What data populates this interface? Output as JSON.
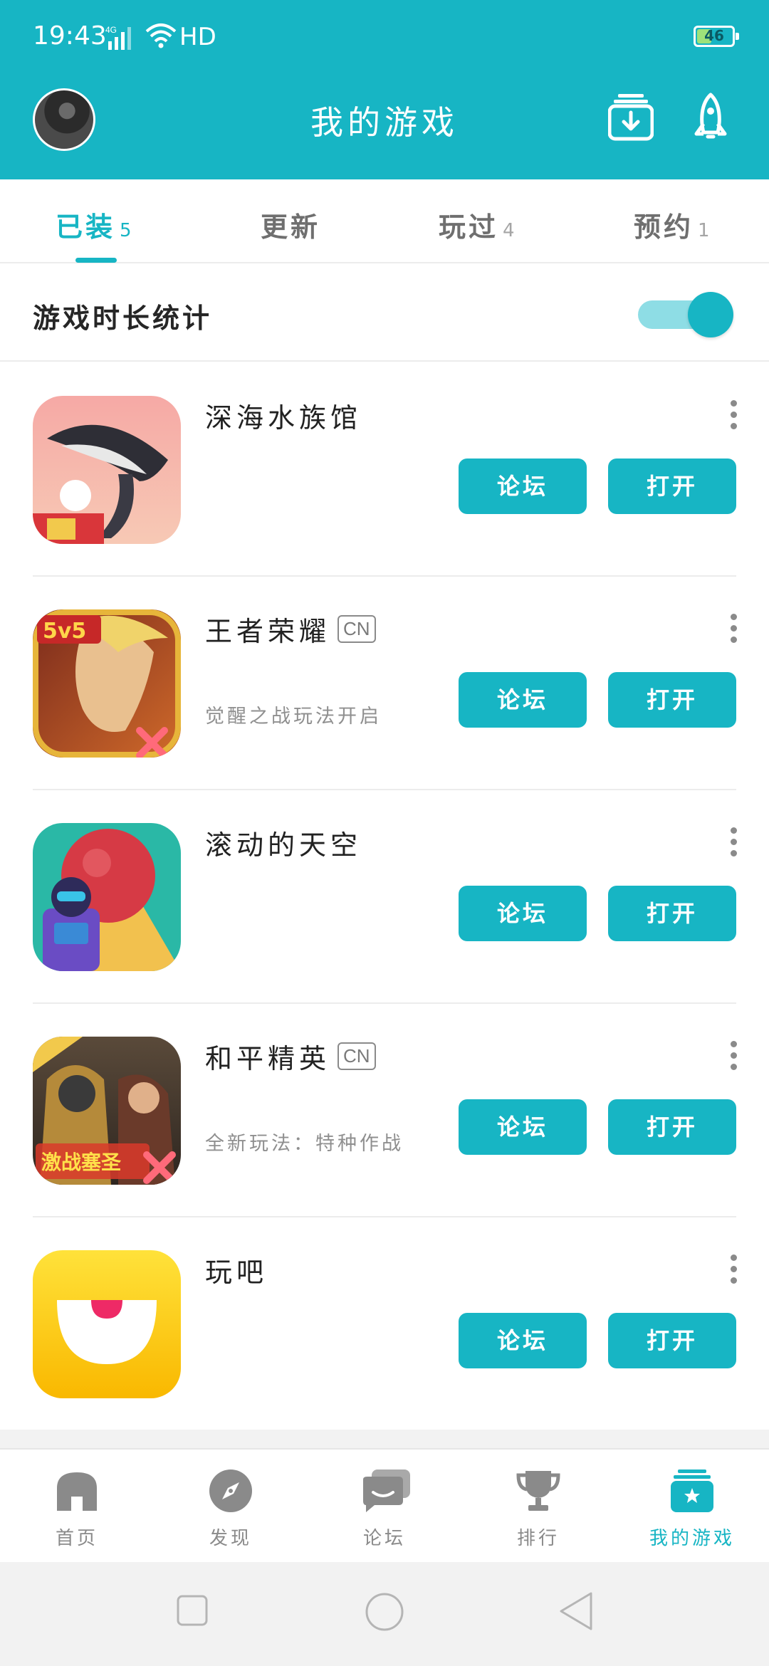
{
  "status_bar": {
    "time": "19:43",
    "network": "4G",
    "wifi_label": "HD",
    "battery": "46",
    "battery_fraction": 0.46
  },
  "header": {
    "title": "我的游戏",
    "download_icon": "download-tray-icon",
    "launch_icon": "rocket-icon"
  },
  "tabs": [
    {
      "label": "已装",
      "count": "5",
      "active": true
    },
    {
      "label": "更新",
      "count": ""
    },
    {
      "label": "玩过",
      "count": "4"
    },
    {
      "label": "预约",
      "count": "1"
    }
  ],
  "playtime_stats": {
    "label": "游戏时长统计",
    "enabled": true
  },
  "games": [
    {
      "name": "深海水族馆",
      "tag": "",
      "desc": "",
      "forum": "论坛",
      "open": "打开",
      "icon_desc": "whale-icon"
    },
    {
      "name": "王者荣耀",
      "tag": "CN",
      "desc": "觉醒之战玩法开启",
      "forum": "论坛",
      "open": "打开",
      "icon_desc": "hero-icon",
      "icon_badge": "5v5"
    },
    {
      "name": "滚动的天空",
      "tag": "",
      "desc": "",
      "forum": "论坛",
      "open": "打开",
      "icon_desc": "ball-icon"
    },
    {
      "name": "和平精英",
      "tag": "CN",
      "desc": "全新玩法：特种作战",
      "forum": "论坛",
      "open": "打开",
      "icon_desc": "soldier-icon",
      "icon_badge": "激战塞圣"
    },
    {
      "name": "玩吧",
      "tag": "",
      "desc": "",
      "forum": "论坛",
      "open": "打开",
      "icon_desc": "smile-icon"
    }
  ],
  "bottom_nav": [
    {
      "label": "首页",
      "icon": "home-icon"
    },
    {
      "label": "发现",
      "icon": "compass-icon"
    },
    {
      "label": "论坛",
      "icon": "chat-icon"
    },
    {
      "label": "排行",
      "icon": "trophy-icon"
    },
    {
      "label": "我的游戏",
      "icon": "my-games-icon",
      "active": true
    }
  ],
  "colors": {
    "accent": "#17b5c4",
    "text": "#222222",
    "muted": "#8f8f8f"
  }
}
